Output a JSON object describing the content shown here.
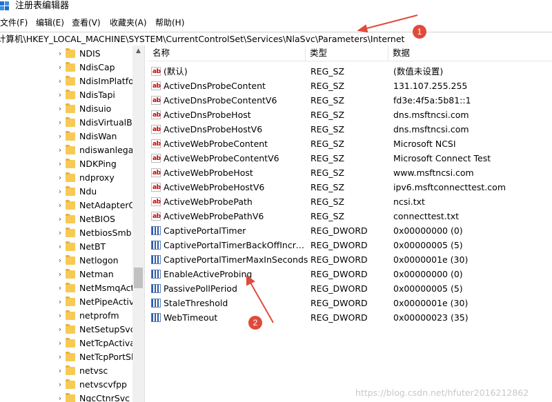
{
  "window": {
    "title": "注册表编辑器"
  },
  "menu": [
    "文件(F)",
    "编辑(E)",
    "查看(V)",
    "收藏夹(A)",
    "帮助(H)"
  ],
  "address": "计算机\\HKEY_LOCAL_MACHINE\\SYSTEM\\CurrentControlSet\\Services\\NlaSvc\\Parameters\\Internet",
  "tree": [
    "NDIS",
    "NdisCap",
    "NdisImPlatfo",
    "NdisTapi",
    "Ndisuio",
    "NdisVirtualBu",
    "NdisWan",
    "ndiswanlegac",
    "NDKPing",
    "ndproxy",
    "Ndu",
    "NetAdapterC",
    "NetBIOS",
    "NetbiosSmb",
    "NetBT",
    "Netlogon",
    "Netman",
    "NetMsmqAct",
    "NetPipeActiva",
    "netprofm",
    "NetSetupSvc",
    "NetTcpActiva",
    "NetTcpPortSl",
    "netvsc",
    "netvscvfpp",
    "NgcCtnrSvc"
  ],
  "columns": {
    "name": "名称",
    "type": "类型",
    "data": "数据"
  },
  "values": [
    {
      "name": "(默认)",
      "type": "REG_SZ",
      "data": "(数值未设置)",
      "icon": "string"
    },
    {
      "name": "ActiveDnsProbeContent",
      "type": "REG_SZ",
      "data": "131.107.255.255",
      "icon": "string"
    },
    {
      "name": "ActiveDnsProbeContentV6",
      "type": "REG_SZ",
      "data": "fd3e:4f5a:5b81::1",
      "icon": "string"
    },
    {
      "name": "ActiveDnsProbeHost",
      "type": "REG_SZ",
      "data": "dns.msftncsi.com",
      "icon": "string"
    },
    {
      "name": "ActiveDnsProbeHostV6",
      "type": "REG_SZ",
      "data": "dns.msftncsi.com",
      "icon": "string"
    },
    {
      "name": "ActiveWebProbeContent",
      "type": "REG_SZ",
      "data": "Microsoft NCSI",
      "icon": "string"
    },
    {
      "name": "ActiveWebProbeContentV6",
      "type": "REG_SZ",
      "data": "Microsoft Connect Test",
      "icon": "string"
    },
    {
      "name": "ActiveWebProbeHost",
      "type": "REG_SZ",
      "data": "www.msftncsi.com",
      "icon": "string"
    },
    {
      "name": "ActiveWebProbeHostV6",
      "type": "REG_SZ",
      "data": "ipv6.msftconnecttest.com",
      "icon": "string"
    },
    {
      "name": "ActiveWebProbePath",
      "type": "REG_SZ",
      "data": "ncsi.txt",
      "icon": "string"
    },
    {
      "name": "ActiveWebProbePathV6",
      "type": "REG_SZ",
      "data": "connecttest.txt",
      "icon": "string"
    },
    {
      "name": "CaptivePortalTimer",
      "type": "REG_DWORD",
      "data": "0x00000000 (0)",
      "icon": "binary"
    },
    {
      "name": "CaptivePortalTimerBackOffIncrem...",
      "type": "REG_DWORD",
      "data": "0x00000005 (5)",
      "icon": "binary"
    },
    {
      "name": "CaptivePortalTimerMaxInSeconds",
      "type": "REG_DWORD",
      "data": "0x0000001e (30)",
      "icon": "binary"
    },
    {
      "name": "EnableActiveProbing",
      "type": "REG_DWORD",
      "data": "0x00000000 (0)",
      "icon": "binary"
    },
    {
      "name": "PassivePollPeriod",
      "type": "REG_DWORD",
      "data": "0x00000005 (5)",
      "icon": "binary"
    },
    {
      "name": "StaleThreshold",
      "type": "REG_DWORD",
      "data": "0x0000001e (30)",
      "icon": "binary"
    },
    {
      "name": "WebTimeout",
      "type": "REG_DWORD",
      "data": "0x00000023 (35)",
      "icon": "binary"
    }
  ],
  "string_icon_text": "ab",
  "annotations": {
    "badge1": "1",
    "badge2": "2",
    "color": "#e04a3b"
  },
  "watermark": "https://blog.csdn.net/hfuter2016212862"
}
